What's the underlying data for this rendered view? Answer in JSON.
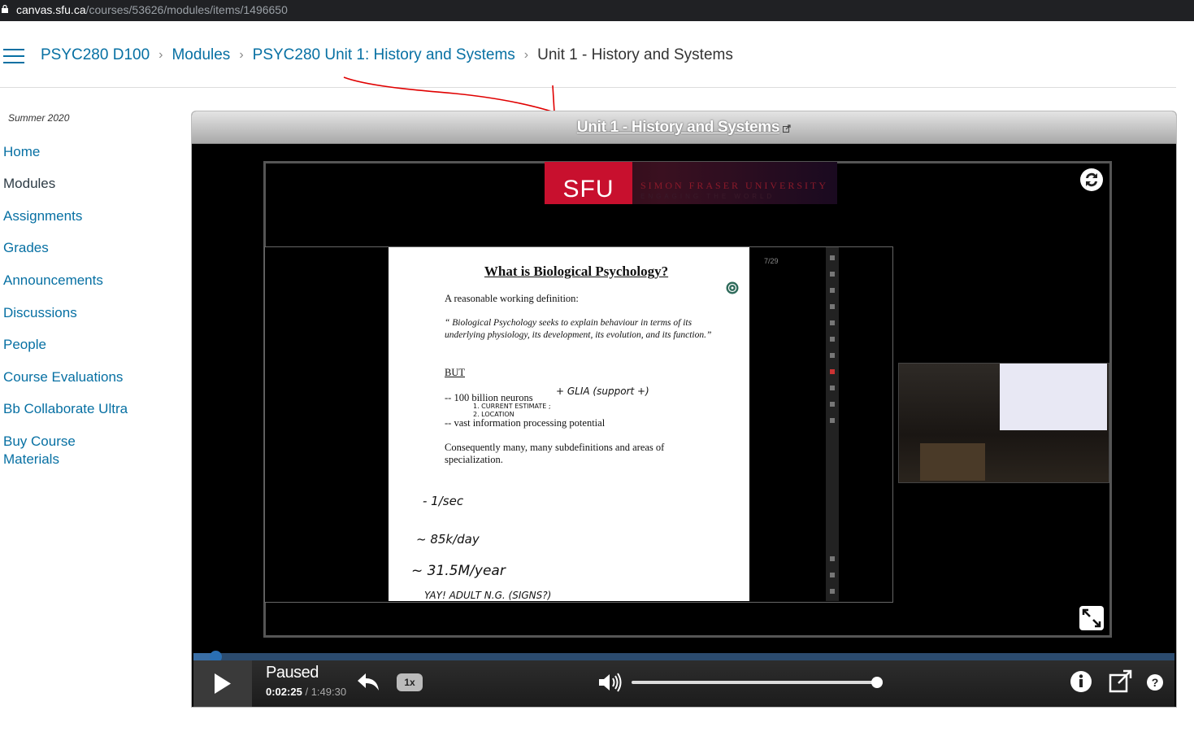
{
  "browser": {
    "domain": "canvas.sfu.ca",
    "path": "/courses/53626/modules/items/1496650"
  },
  "breadcrumb": {
    "course": "PSYC280 D100",
    "modules": "Modules",
    "unit": "PSYC280 Unit 1: History and Systems",
    "current": "Unit 1 - History and Systems"
  },
  "sidebar": {
    "term": "Summer 2020",
    "items": [
      "Home",
      "Modules",
      "Assignments",
      "Grades",
      "Announcements",
      "Discussions",
      "People",
      "Course Evaluations",
      "Bb Collaborate Ultra",
      "Buy Course",
      "Materials"
    ]
  },
  "frame": {
    "title": "Unit 1 - History and Systems"
  },
  "video": {
    "banner_logo": "SFU",
    "banner_text": "SIMON FRASER UNIVERSITY",
    "banner_sub": "ENGAGING THE WORLD",
    "slide_counter": "7/29",
    "slide": {
      "title": "What is Biological Psychology?",
      "intro": "A reasonable working definition:",
      "quote1": "“ Biological Psychology seeks to explain behaviour in terms of its",
      "quote2": "underlying physiology, its development, its evolution, and its function.”",
      "but": "BUT",
      "bullet1": "--  100 billion neurons",
      "bullet2": "--  vast information processing potential",
      "conclusion1": "Consequently many, many subdefinitions and areas of",
      "conclusion2": "specialization.",
      "hw_glia": "+    GLIA  (support +)",
      "hw_note1": "1. CURRENT  ESTIMATE ;",
      "hw_note2": "2. LOCATION",
      "hw_rate1": "- 1/sec",
      "hw_rate2": "~ 85k/day",
      "hw_rate3": "~ 31.5M/year",
      "hw_bottom": "YAY!     ADULT  N.G.   (SIGNS?)"
    }
  },
  "player": {
    "status": "Paused",
    "current_time": "0:02:25",
    "separator": "/",
    "total_time": "1:49:30",
    "speed": "1x",
    "progress": 0.022,
    "volume": 1.0
  },
  "colors": {
    "link": "#0770a3",
    "annotation": "#e00000",
    "progress": "#3a6ea5"
  }
}
